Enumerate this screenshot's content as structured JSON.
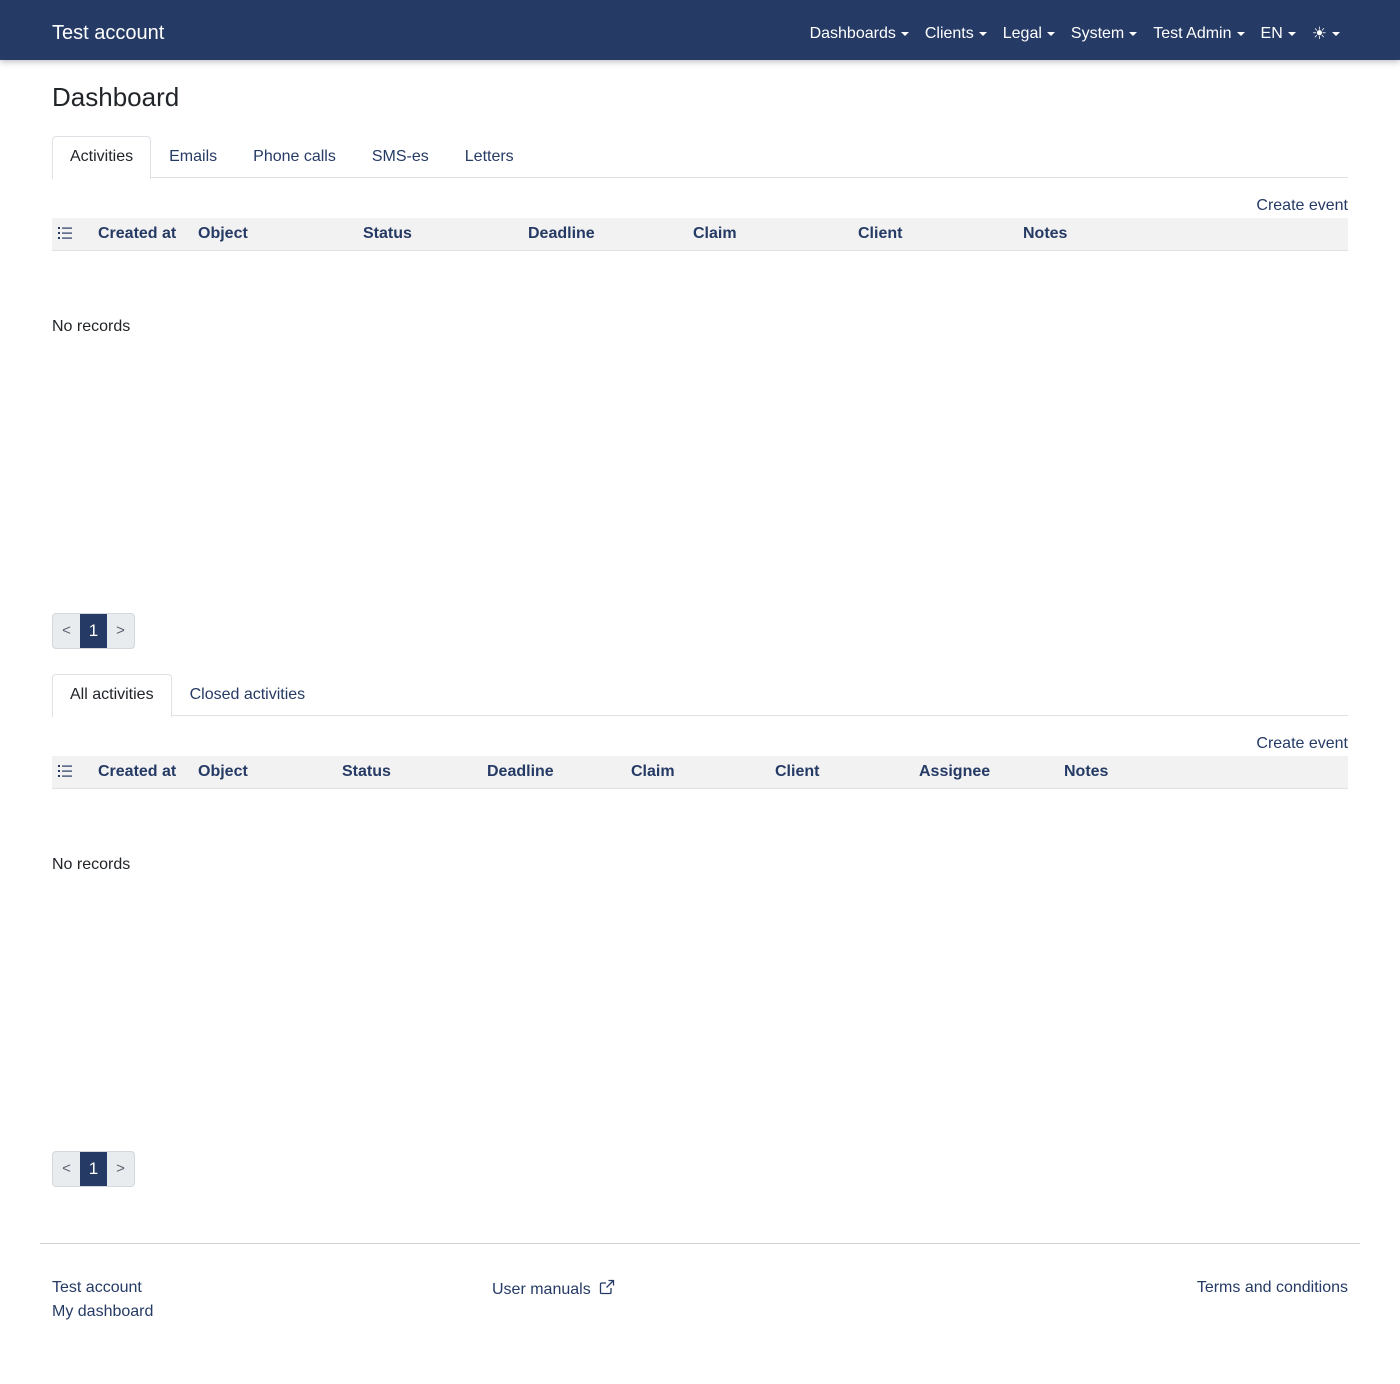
{
  "navbar": {
    "brand": "Test account",
    "items": [
      {
        "label": "Dashboards"
      },
      {
        "label": "Clients"
      },
      {
        "label": "Legal"
      },
      {
        "label": "System"
      },
      {
        "label": "Test Admin"
      },
      {
        "label": "EN"
      }
    ],
    "theme_icon": "sun-icon"
  },
  "page": {
    "title": "Dashboard"
  },
  "section1": {
    "tabs": [
      "Activities",
      "Emails",
      "Phone calls",
      "SMS-es",
      "Letters"
    ],
    "active_tab": "Activities",
    "create_label": "Create event",
    "columns": [
      "Created at",
      "Object",
      "Status",
      "Deadline",
      "Claim",
      "Client",
      "Notes"
    ],
    "empty_text": "No records",
    "pager": {
      "prev": "<",
      "current": "1",
      "next": ">"
    }
  },
  "section2": {
    "tabs": [
      "All activities",
      "Closed activities"
    ],
    "active_tab": "All activities",
    "create_label": "Create event",
    "columns": [
      "Created at",
      "Object",
      "Status",
      "Deadline",
      "Claim",
      "Client",
      "Assignee",
      "Notes"
    ],
    "empty_text": "No records",
    "pager": {
      "prev": "<",
      "current": "1",
      "next": ">"
    }
  },
  "footer": {
    "account": "Test account",
    "dashboard": "My dashboard",
    "manuals": "User manuals",
    "terms": "Terms and conditions"
  },
  "colors": {
    "navbar": "#253a64",
    "link": "#253a64",
    "header_bg": "#f2f2f2"
  }
}
